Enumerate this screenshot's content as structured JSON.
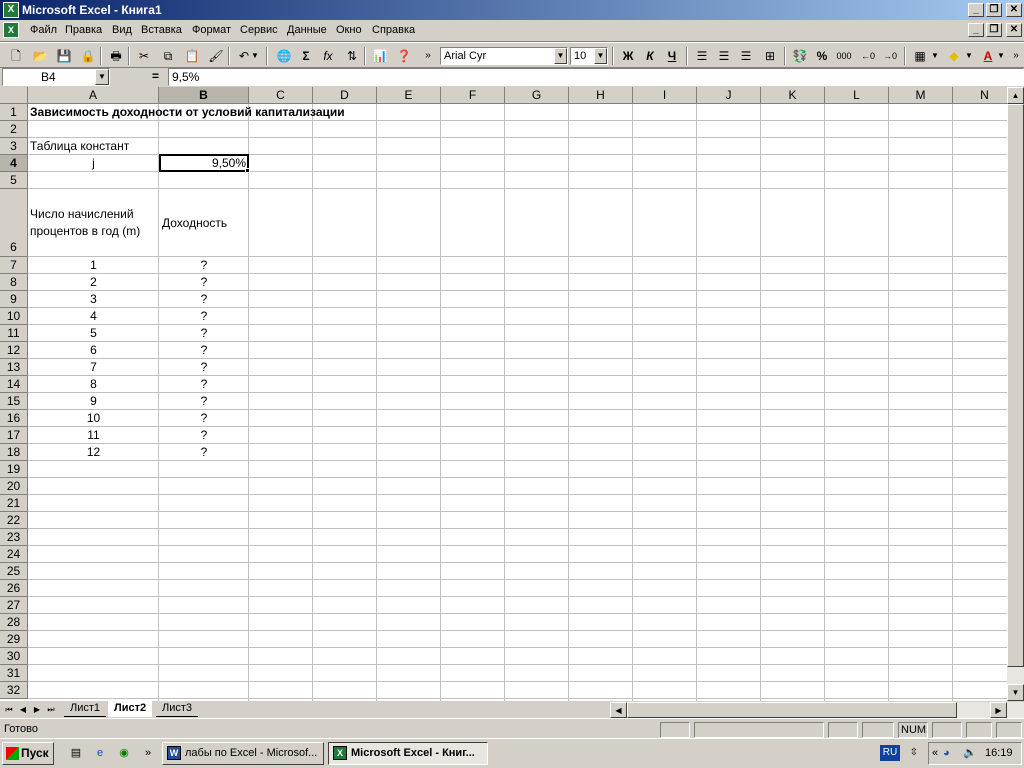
{
  "window": {
    "title": "Microsoft Excel - Книга1",
    "app_icon": "X"
  },
  "menu": [
    "Файл",
    "Правка",
    "Вид",
    "Вставка",
    "Формат",
    "Сервис",
    "Данные",
    "Окно",
    "Справка"
  ],
  "toolbar": {
    "font": "Arial Cyr",
    "size": "10",
    "bold": "Ж",
    "italic": "К",
    "underline": "Ч",
    "sigma": "Σ",
    "fx": "fx",
    "percent": "%",
    "thousands": "000"
  },
  "formula_bar": {
    "name_box": "B4",
    "equals": "=",
    "value": "9,5%"
  },
  "columns": [
    "A",
    "B",
    "C",
    "D",
    "E",
    "F",
    "G",
    "H",
    "I",
    "J",
    "K",
    "L",
    "M",
    "N"
  ],
  "rows": [
    "1",
    "2",
    "3",
    "4",
    "5",
    "6",
    "7",
    "8",
    "9",
    "10",
    "11",
    "12",
    "13",
    "14",
    "15",
    "16",
    "17",
    "18",
    "19",
    "20",
    "21",
    "22",
    "23",
    "24",
    "25",
    "26",
    "27",
    "28",
    "29",
    "30",
    "31",
    "32"
  ],
  "cells": {
    "a1": "Зависимость доходности от условий капитализации",
    "a3": "Таблица констант",
    "a4": "j",
    "b4": "9,50%",
    "a6_line1": "Число начислений",
    "a6_line2": "процентов в год (m)",
    "b6": "Доходность",
    "m_values": [
      "1",
      "2",
      "3",
      "4",
      "5",
      "6",
      "7",
      "8",
      "9",
      "10",
      "11",
      "12"
    ],
    "q_values": [
      "?",
      "?",
      "?",
      "?",
      "?",
      "?",
      "?",
      "?",
      "?",
      "?",
      "?",
      "?"
    ]
  },
  "sheets": [
    "Лист1",
    "Лист2",
    "Лист3"
  ],
  "active_sheet": "Лист2",
  "status": {
    "ready": "Готово",
    "num": "NUM"
  },
  "taskbar": {
    "start": "Пуск",
    "tasks": [
      "лабы по Excel - Microsof...",
      "Microsoft Excel - Книг..."
    ],
    "lang": "RU",
    "chevron": "«",
    "quick_chevron": "»",
    "clock": "16:19"
  }
}
